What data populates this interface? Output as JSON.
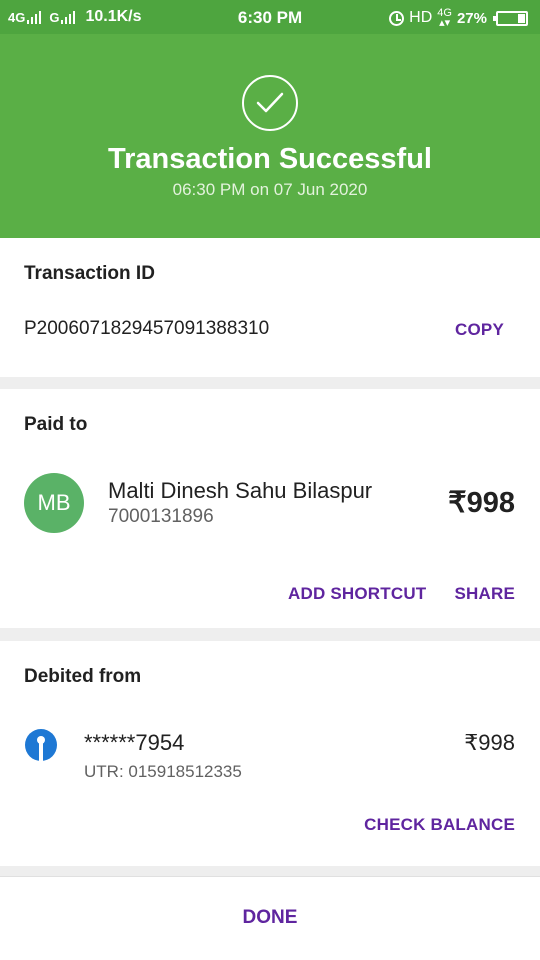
{
  "status_bar": {
    "network1": "4G",
    "network2": "G",
    "speed": "10.1K/s",
    "time": "6:30 PM",
    "hd": "HD",
    "network3": "4G",
    "battery": "27%",
    "battery_level": 0.27
  },
  "header": {
    "title": "Transaction Successful",
    "subtitle": "06:30 PM on 07 Jun 2020",
    "color": "#5aaf46"
  },
  "transaction": {
    "title": "Transaction ID",
    "id": "P2006071829457091388310",
    "copy_label": "COPY"
  },
  "paid_to": {
    "title": "Paid to",
    "avatar_initials": "MB",
    "name": "Malti Dinesh Sahu Bilaspur",
    "phone": "7000131896",
    "amount": "₹998",
    "add_shortcut_label": "ADD SHORTCUT",
    "share_label": "SHARE"
  },
  "debited_from": {
    "title": "Debited from",
    "bank_icon": "sbi-bank-icon",
    "account": "******7954",
    "utr": "UTR: 015918512335",
    "amount": "₹998",
    "check_balance_label": "CHECK BALANCE"
  },
  "footer": {
    "done_label": "DONE"
  },
  "accent_color": "#5f259f"
}
